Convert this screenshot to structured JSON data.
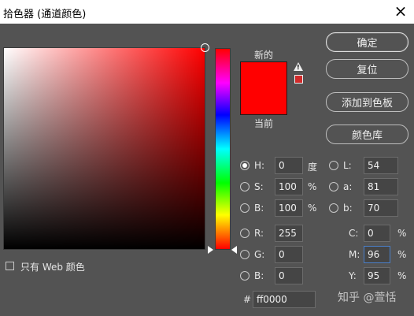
{
  "window": {
    "title": "拾色器 (通道颜色)",
    "close": "×"
  },
  "swatches": {
    "new_label": "新的",
    "current_label": "当前",
    "warning_mark": "!"
  },
  "buttons": {
    "ok": "确定",
    "reset": "复位",
    "add_to_swatches": "添加到色板",
    "color_libraries": "颜色库"
  },
  "hsb": {
    "h": {
      "label": "H:",
      "value": "0",
      "unit": "度"
    },
    "s": {
      "label": "S:",
      "value": "100",
      "unit": "%"
    },
    "b": {
      "label": "B:",
      "value": "100",
      "unit": "%"
    }
  },
  "rgb": {
    "r": {
      "label": "R:",
      "value": "255"
    },
    "g": {
      "label": "G:",
      "value": "0"
    },
    "b": {
      "label": "B:",
      "value": "0"
    }
  },
  "lab": {
    "l": {
      "label": "L:",
      "value": "54"
    },
    "a": {
      "label": "a:",
      "value": "81"
    },
    "b": {
      "label": "b:",
      "value": "70"
    }
  },
  "cmyk": {
    "c": {
      "label": "C:",
      "value": "0",
      "unit": "%"
    },
    "m": {
      "label": "M:",
      "value": "96",
      "unit": "%"
    },
    "y": {
      "label": "Y:",
      "value": "95",
      "unit": "%"
    }
  },
  "hex": {
    "label": "#",
    "value": "ff0000"
  },
  "web_only": {
    "label": "只有 Web 颜色"
  },
  "colors": {
    "selected": "#ff0000",
    "dialog_bg": "#535353"
  },
  "watermark": "知乎 @萱恬"
}
